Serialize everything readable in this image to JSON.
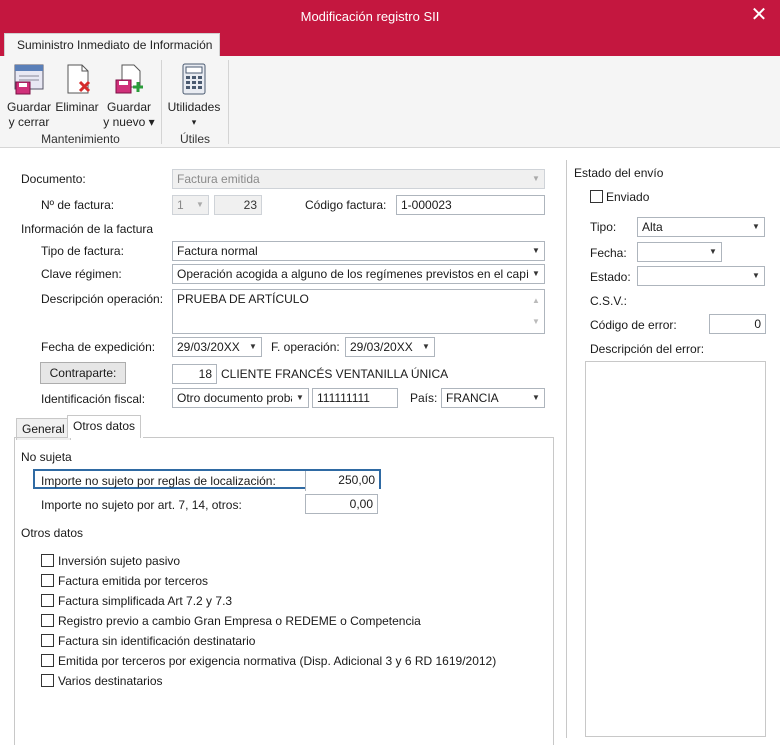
{
  "window": {
    "title": "Modificación registro SII",
    "close_icon": "close-icon"
  },
  "ribbon": {
    "tab_label": "Suministro Inmediato de Información",
    "buttons": {
      "guardar_cerrar": {
        "line1": "Guardar",
        "line2": "y cerrar"
      },
      "eliminar": {
        "line1": "Eliminar"
      },
      "guardar_nuevo": {
        "line1": "Guardar",
        "line2": "y nuevo ▾"
      },
      "utilidades": {
        "line1": "Utilidades",
        "line2": "▾"
      }
    },
    "groups": {
      "mantenimiento": "Mantenimiento",
      "utiles": "Útiles"
    }
  },
  "form": {
    "documento_label": "Documento:",
    "documento_value": "Factura emitida",
    "num_factura_label": "Nº de factura:",
    "num_factura_serie": "1",
    "num_factura_num": "23",
    "codigo_factura_label": "Código factura:",
    "codigo_factura_value": "1-000023",
    "info_factura_label": "Información de la factura",
    "tipo_factura_label": "Tipo de factura:",
    "tipo_factura_value": "Factura normal",
    "clave_regimen_label": "Clave régimen:",
    "clave_regimen_value": "Operación acogida a alguno de los regímenes previstos en el capítulo",
    "descripcion_label": "Descripción operación:",
    "descripcion_value": "PRUEBA DE ARTÍCULO",
    "fecha_expedicion_label": "Fecha de expedición:",
    "fecha_expedicion_value": "29/03/20XX",
    "f_operacion_label": "F. operación:",
    "f_operacion_value": "29/03/20XX",
    "contraparte_button": "Contraparte:",
    "contraparte_num": "18",
    "contraparte_name": "CLIENTE FRANCÉS VENTANILLA ÚNICA",
    "id_fiscal_label": "Identificación fiscal:",
    "id_fiscal_type": "Otro documento probatorio",
    "id_fiscal_value": "111111111",
    "pais_label": "País:",
    "pais_value": "FRANCIA"
  },
  "tabs": {
    "general": "General",
    "otros_datos": "Otros datos"
  },
  "no_sujeta": {
    "title": "No sujeta",
    "importe_localizacion_label": "Importe no sujeto por reglas de localización:",
    "importe_localizacion_value": "250,00",
    "importe_art_label": "Importe no sujeto por art. 7, 14, otros:",
    "importe_art_value": "0,00"
  },
  "otros_datos": {
    "title": "Otros datos",
    "checks": [
      "Inversión sujeto pasivo",
      "Factura emitida por terceros",
      "Factura simplificada Art 7.2 y 7.3",
      "Registro previo a cambio Gran Empresa o REDEME o Competencia",
      "Factura sin identificación destinatario",
      "Emitida por terceros por exigencia normativa (Disp. Adicional 3 y 6 RD 1619/2012)",
      "Varios destinatarios"
    ]
  },
  "estado_envio": {
    "title": "Estado del envío",
    "enviado_label": "Enviado",
    "tipo_label": "Tipo:",
    "tipo_value": "Alta",
    "fecha_label": "Fecha:",
    "fecha_value": "",
    "estado_label": "Estado:",
    "estado_value": "",
    "csv_label": "C.S.V.:",
    "codigo_error_label": "Código de error:",
    "codigo_error_value": "0",
    "descripcion_error_label": "Descripción del error:"
  }
}
